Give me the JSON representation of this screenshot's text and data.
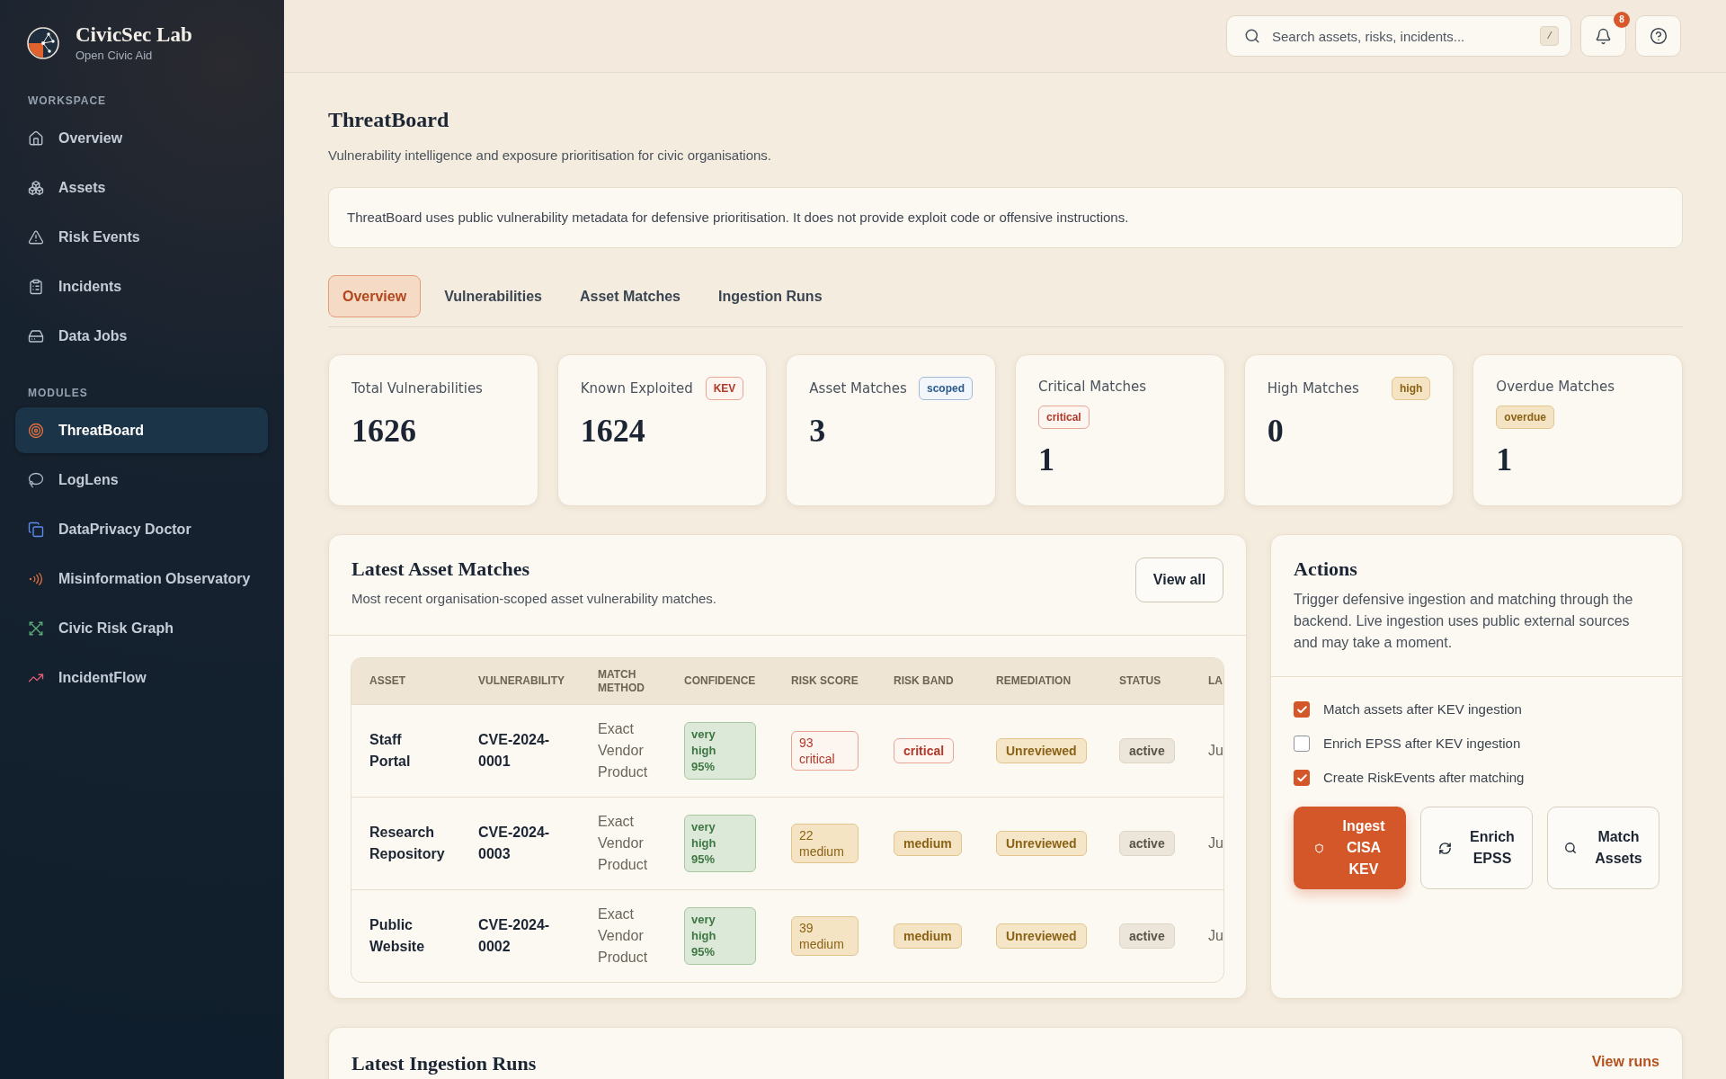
{
  "sidebar": {
    "brand": {
      "name": "CivicSec Lab",
      "tagline": "Open Civic Aid"
    },
    "sections": [
      {
        "heading": "WORKSPACE",
        "items": [
          {
            "label": "Overview",
            "selected": false
          },
          {
            "label": "Assets",
            "selected": false
          },
          {
            "label": "Risk Events",
            "selected": false
          },
          {
            "label": "Incidents",
            "selected": false
          },
          {
            "label": "Data Jobs",
            "selected": false
          }
        ]
      },
      {
        "heading": "MODULES",
        "items": [
          {
            "label": "ThreatBoard",
            "selected": true
          },
          {
            "label": "LogLens",
            "selected": false
          },
          {
            "label": "DataPrivacy Doctor",
            "selected": false
          },
          {
            "label": "Misinformation Observatory",
            "selected": false
          },
          {
            "label": "Civic Risk Graph",
            "selected": false
          },
          {
            "label": "IncidentFlow",
            "selected": false
          }
        ]
      }
    ]
  },
  "top_bar": {
    "search": {
      "placeholder": "Search assets, risks, incidents...",
      "shortcut": "/"
    },
    "notifications": {
      "count": "8"
    }
  },
  "page": {
    "title": "ThreatBoard",
    "subtitle": "Vulnerability intelligence and exposure prioritisation for civic organisations.",
    "notice": "ThreatBoard uses public vulnerability metadata for defensive prioritisation. It does not provide exploit code or offensive instructions."
  },
  "tabs": [
    {
      "label": "Overview",
      "selected": true
    },
    {
      "label": "Vulnerabilities",
      "selected": false
    },
    {
      "label": "Asset Matches",
      "selected": false
    },
    {
      "label": "Ingestion Runs",
      "selected": false
    }
  ],
  "stats": [
    {
      "label": "Total Vulnerabilities",
      "value": "1626"
    },
    {
      "label": "Known Exploited",
      "value": "1624",
      "badge": {
        "text": "KEV",
        "kind": "kev"
      }
    },
    {
      "label": "Asset Matches",
      "value": "3",
      "badge": {
        "text": "scoped",
        "kind": "scoped"
      }
    },
    {
      "label": "Critical Matches",
      "value": "1",
      "badge": {
        "text": "critical",
        "kind": "critical"
      }
    },
    {
      "label": "High Matches",
      "value": "0",
      "badge": {
        "text": "high",
        "kind": "high"
      }
    },
    {
      "label": "Overdue Matches",
      "value": "1",
      "badge": {
        "text": "overdue",
        "kind": "overdue"
      }
    }
  ],
  "asset_matches": {
    "title": "Latest Asset Matches",
    "subtitle": "Most recent organisation-scoped asset vulnerability matches.",
    "view_all": "View all",
    "table": {
      "columns": [
        "ASSET",
        "VULNERABILITY",
        "MATCH METHOD",
        "CONFIDENCE",
        "RISK SCORE",
        "RISK BAND",
        "REMEDIATION",
        "STATUS",
        "LA"
      ],
      "rows": [
        {
          "asset": "Staff Portal",
          "vulnerability": "CVE-2024-0001",
          "match_method": "Exact Vendor Product",
          "confidence": "very high 95%",
          "risk_score": {
            "value": "93",
            "band": "critical",
            "kind": "critical"
          },
          "risk_band": {
            "text": "critical",
            "kind": "critical"
          },
          "remediation": "Unreviewed",
          "status": "active",
          "column_9": "Ju"
        },
        {
          "asset": "Research Repository",
          "vulnerability": "CVE-2024-0003",
          "match_method": "Exact Vendor Product",
          "confidence": "very high 95%",
          "risk_score": {
            "value": "22",
            "band": "medium",
            "kind": "medium"
          },
          "risk_band": {
            "text": "medium",
            "kind": "medium"
          },
          "remediation": "Unreviewed",
          "status": "active",
          "column_9": "Ju"
        },
        {
          "asset": "Public Website",
          "vulnerability": "CVE-2024-0002",
          "match_method": "Exact Vendor Product",
          "confidence": "very high 95%",
          "risk_score": {
            "value": "39",
            "band": "medium",
            "kind": "medium"
          },
          "risk_band": {
            "text": "medium",
            "kind": "medium"
          },
          "remediation": "Unreviewed",
          "status": "active",
          "column_9": "Ju"
        }
      ]
    }
  },
  "actions": {
    "title": "Actions",
    "description": "Trigger defensive ingestion and matching through the backend. Live ingestion uses public external sources and may take a moment.",
    "options": [
      {
        "label": "Match assets after KEV ingestion",
        "checked": true
      },
      {
        "label": "Enrich EPSS after KEV ingestion",
        "checked": false
      },
      {
        "label": "Create RiskEvents after matching",
        "checked": true
      }
    ],
    "buttons": [
      {
        "label": "Ingest CISA KEV",
        "kind": "primary"
      },
      {
        "label": "Enrich EPSS",
        "kind": "secondary"
      },
      {
        "label": "Match Assets",
        "kind": "secondary"
      }
    ]
  },
  "ingestion_runs": {
    "title": "Latest Ingestion Runs",
    "link": "View runs"
  }
}
